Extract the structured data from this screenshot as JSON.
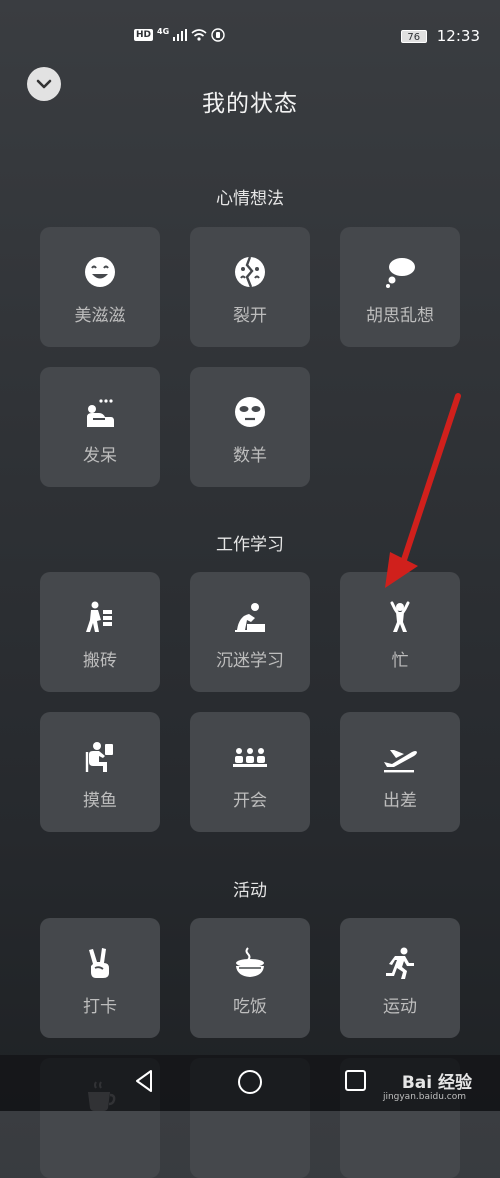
{
  "status_bar": {
    "hd": "HD",
    "network": "4G",
    "battery": "76",
    "time": "12:33"
  },
  "header": {
    "title": "我的状态",
    "back_icon": "chevron-down-icon"
  },
  "sections": [
    {
      "title": "心情想法",
      "items": [
        {
          "label": "美滋滋",
          "icon": "smile-face-icon"
        },
        {
          "label": "裂开",
          "icon": "cracked-face-icon"
        },
        {
          "label": "胡思乱想",
          "icon": "thought-bubble-icon"
        },
        {
          "label": "发呆",
          "icon": "daydream-person-icon"
        },
        {
          "label": "数羊",
          "icon": "sleep-mask-face-icon"
        }
      ]
    },
    {
      "title": "工作学习",
      "items": [
        {
          "label": "搬砖",
          "icon": "carry-bricks-icon"
        },
        {
          "label": "沉迷学习",
          "icon": "study-person-icon"
        },
        {
          "label": "忙",
          "icon": "busy-person-icon"
        },
        {
          "label": "摸鱼",
          "icon": "slacking-person-icon"
        },
        {
          "label": "开会",
          "icon": "meeting-icon"
        },
        {
          "label": "出差",
          "icon": "airplane-icon"
        }
      ]
    },
    {
      "title": "活动",
      "items": [
        {
          "label": "打卡",
          "icon": "victory-hand-icon"
        },
        {
          "label": "吃饭",
          "icon": "rice-bowl-icon"
        },
        {
          "label": "运动",
          "icon": "running-icon"
        }
      ]
    }
  ],
  "nav": {
    "back": "nav-back-icon",
    "home": "nav-home-icon",
    "recents": "nav-recents-icon"
  },
  "watermark": {
    "brand": "Bai 经验",
    "url": "jingyan.baidu.com"
  },
  "annotation": {
    "color": "#d0201c"
  }
}
